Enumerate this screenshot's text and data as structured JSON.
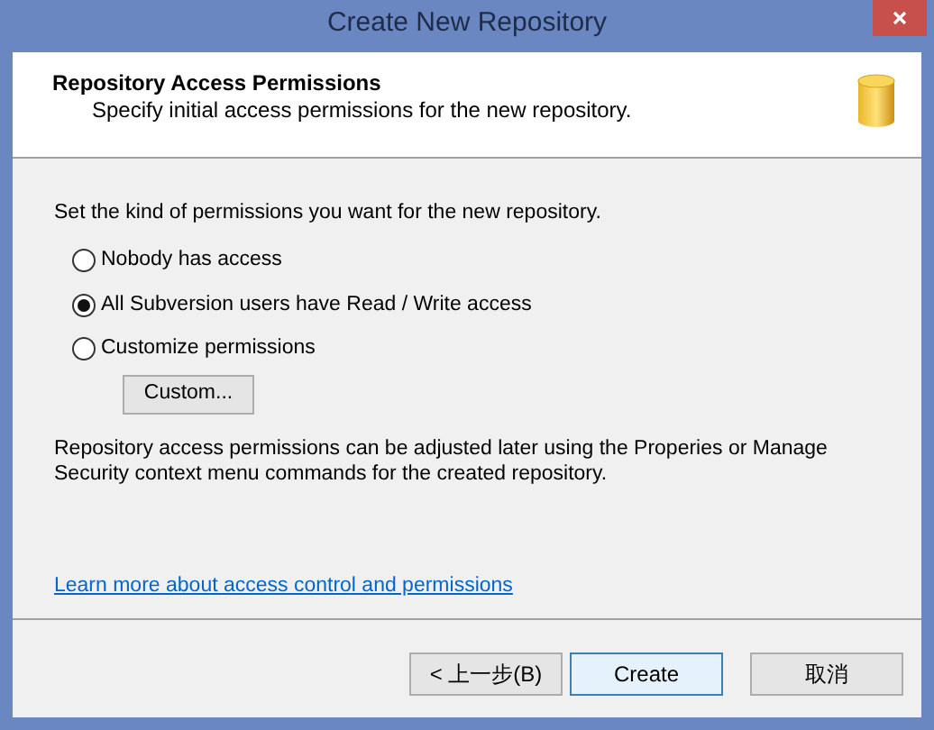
{
  "window": {
    "title": "Create New Repository"
  },
  "header": {
    "title": "Repository Access Permissions",
    "subtitle": "Specify initial access permissions for the new repository."
  },
  "prompt": "Set the kind of permissions you want for the new repository.",
  "options": [
    {
      "label": "Nobody has access",
      "selected": false
    },
    {
      "label": "All Subversion users have Read / Write access",
      "selected": true
    },
    {
      "label": "Customize permissions",
      "selected": false
    }
  ],
  "custom_button": "Custom...",
  "note": "Repository access permissions can be adjusted later using the Properies or Manage Security context menu commands for the created repository.",
  "link": "Learn more about access control and permissions",
  "buttons": [
    {
      "label": "< 上一步(B)",
      "default": false
    },
    {
      "label": "Create",
      "default": true
    },
    {
      "label": "取消",
      "default": false
    }
  ]
}
